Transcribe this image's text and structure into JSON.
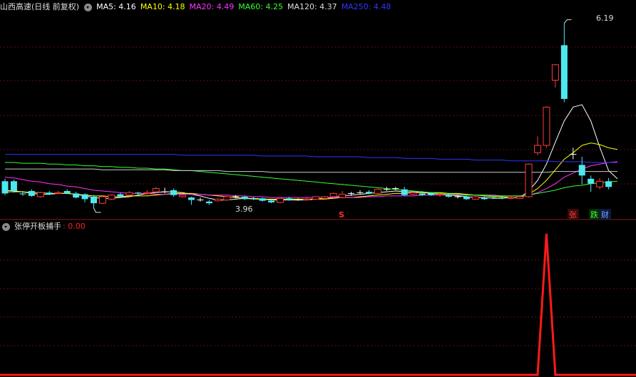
{
  "main_panel": {
    "title": "山西高速(日线 前复权)",
    "ma_items": [
      {
        "label": "MA5: 4.16",
        "color": "#ffffff"
      },
      {
        "label": "MA10: 4.18",
        "color": "#ffff00"
      },
      {
        "label": "MA20: 4.49",
        "color": "#ff33ff"
      },
      {
        "label": "MA60: 4.25",
        "color": "#33ff33"
      },
      {
        "label": "MA120: 4.37",
        "color": "#dddddd"
      },
      {
        "label": "MA250: 4.48",
        "color": "#3333ff"
      }
    ],
    "high_label": "6.19",
    "low_label": "3.96",
    "marker_s": "S",
    "marker_zhang": "张",
    "marker_die": "跌",
    "marker_cai": "财"
  },
  "sub_panel": {
    "title": "张停开板捕手",
    "value": ": 0.00",
    "value_color": "#ff2020"
  },
  "colors": {
    "up": "#ff3b3b",
    "down": "#4de8f0",
    "signal": "#ff1a1a"
  },
  "chart_data": {
    "type": "candlestick",
    "candles": [
      {
        "o": 4.25,
        "c": 4.1,
        "h": 4.28,
        "l": 4.08
      },
      {
        "o": 4.25,
        "c": 4.13,
        "h": 4.27,
        "l": 4.11
      },
      {
        "o": 4.1,
        "c": 4.09,
        "h": 4.13,
        "l": 4.07
      },
      {
        "o": 4.13,
        "c": 4.07,
        "h": 4.15,
        "l": 4.06
      },
      {
        "o": 4.06,
        "c": 4.11,
        "h": 4.12,
        "l": 4.05
      },
      {
        "o": 4.11,
        "c": 4.09,
        "h": 4.13,
        "l": 4.08
      },
      {
        "o": 4.1,
        "c": 4.11,
        "h": 4.13,
        "l": 4.09
      },
      {
        "o": 4.13,
        "c": 4.1,
        "h": 4.15,
        "l": 4.09
      },
      {
        "o": 4.1,
        "c": 4.05,
        "h": 4.12,
        "l": 4.04
      },
      {
        "o": 4.09,
        "c": 4.03,
        "h": 4.1,
        "l": 3.99
      },
      {
        "o": 4.06,
        "c": 3.98,
        "h": 4.08,
        "l": 3.92
      },
      {
        "o": 3.98,
        "c": 4.06,
        "h": 4.08,
        "l": 3.97
      },
      {
        "o": 4.03,
        "c": 4.08,
        "h": 4.09,
        "l": 4.02
      },
      {
        "o": 4.09,
        "c": 4.06,
        "h": 4.11,
        "l": 4.05
      },
      {
        "o": 4.08,
        "c": 4.11,
        "h": 4.13,
        "l": 4.07
      },
      {
        "o": 4.11,
        "c": 4.1,
        "h": 4.12,
        "l": 4.08
      },
      {
        "o": 4.1,
        "c": 4.11,
        "h": 4.14,
        "l": 4.08
      },
      {
        "o": 4.12,
        "c": 4.16,
        "h": 4.18,
        "l": 4.1
      },
      {
        "o": 4.12,
        "c": 4.12,
        "h": 4.17,
        "l": 4.1
      },
      {
        "o": 4.14,
        "c": 4.08,
        "h": 4.16,
        "l": 4.06
      },
      {
        "o": 4.06,
        "c": 4.08,
        "h": 4.09,
        "l": 4.05
      },
      {
        "o": 4.05,
        "c": 4.02,
        "h": 4.06,
        "l": 3.96
      },
      {
        "o": 4.02,
        "c": 4.02,
        "h": 4.05,
        "l": 4.0
      },
      {
        "o": 4.0,
        "c": 3.98,
        "h": 4.02,
        "l": 3.96
      },
      {
        "o": 4.01,
        "c": 4.03,
        "h": 4.04,
        "l": 4.0
      },
      {
        "o": 4.02,
        "c": 4.06,
        "h": 4.07,
        "l": 4.01
      },
      {
        "o": 4.06,
        "c": 4.06,
        "h": 4.08,
        "l": 4.04
      },
      {
        "o": 4.06,
        "c": 4.03,
        "h": 4.07,
        "l": 4.02
      },
      {
        "o": 4.04,
        "c": 4.03,
        "h": 4.06,
        "l": 4.02
      },
      {
        "o": 4.04,
        "c": 4.01,
        "h": 4.05,
        "l": 4.0
      },
      {
        "o": 4.01,
        "c": 3.99,
        "h": 4.03,
        "l": 3.98
      },
      {
        "o": 3.99,
        "c": 4.04,
        "h": 4.05,
        "l": 3.98
      },
      {
        "o": 4.04,
        "c": 4.02,
        "h": 4.06,
        "l": 4.01
      },
      {
        "o": 4.02,
        "c": 4.02,
        "h": 4.04,
        "l": 4.01
      },
      {
        "o": 4.02,
        "c": 4.03,
        "h": 4.05,
        "l": 4.01
      },
      {
        "o": 4.03,
        "c": 4.06,
        "h": 4.07,
        "l": 4.02
      },
      {
        "o": 4.04,
        "c": 4.06,
        "h": 4.07,
        "l": 4.03
      },
      {
        "o": 4.06,
        "c": 4.1,
        "h": 4.11,
        "l": 4.05
      },
      {
        "o": 4.05,
        "c": 4.09,
        "h": 4.13,
        "l": 4.04
      },
      {
        "o": 4.1,
        "c": 4.1,
        "h": 4.12,
        "l": 4.07
      },
      {
        "o": 4.11,
        "c": 4.11,
        "h": 4.14,
        "l": 4.09
      },
      {
        "o": 4.12,
        "c": 4.1,
        "h": 4.14,
        "l": 4.09
      },
      {
        "o": 4.1,
        "c": 4.15,
        "h": 4.16,
        "l": 4.09
      },
      {
        "o": 4.15,
        "c": 4.15,
        "h": 4.18,
        "l": 4.13
      },
      {
        "o": 4.16,
        "c": 4.16,
        "h": 4.18,
        "l": 4.14
      },
      {
        "o": 4.15,
        "c": 4.08,
        "h": 4.18,
        "l": 4.07
      },
      {
        "o": 4.09,
        "c": 4.11,
        "h": 4.12,
        "l": 4.08
      },
      {
        "o": 4.1,
        "c": 4.08,
        "h": 4.13,
        "l": 4.07
      },
      {
        "o": 4.1,
        "c": 4.08,
        "h": 4.11,
        "l": 4.07
      },
      {
        "o": 4.08,
        "c": 4.09,
        "h": 4.1,
        "l": 4.06
      },
      {
        "o": 4.08,
        "c": 4.06,
        "h": 4.1,
        "l": 4.05
      },
      {
        "o": 4.06,
        "c": 4.06,
        "h": 4.08,
        "l": 4.04
      },
      {
        "o": 4.06,
        "c": 4.03,
        "h": 4.07,
        "l": 4.02
      },
      {
        "o": 4.03,
        "c": 4.06,
        "h": 4.07,
        "l": 4.02
      },
      {
        "o": 4.05,
        "c": 4.03,
        "h": 4.06,
        "l": 4.02
      },
      {
        "o": 4.05,
        "c": 4.04,
        "h": 4.06,
        "l": 4.03
      },
      {
        "o": 4.05,
        "c": 4.04,
        "h": 4.06,
        "l": 4.03
      },
      {
        "o": 4.04,
        "c": 4.05,
        "h": 4.07,
        "l": 4.03
      },
      {
        "o": 4.04,
        "c": 4.06,
        "h": 4.07,
        "l": 4.03
      },
      {
        "o": 4.06,
        "c": 4.46,
        "h": 4.47,
        "l": 4.05
      },
      {
        "o": 4.6,
        "c": 4.69,
        "h": 4.8,
        "l": 4.57
      },
      {
        "o": 4.69,
        "c": 5.16,
        "h": 5.17,
        "l": 4.66
      },
      {
        "o": 5.49,
        "c": 5.68,
        "h": 5.69,
        "l": 5.4
      },
      {
        "o": 5.92,
        "c": 5.26,
        "h": 6.19,
        "l": 5.22
      },
      {
        "o": 4.58,
        "c": 4.58,
        "h": 4.66,
        "l": 4.52
      },
      {
        "o": 4.45,
        "c": 4.32,
        "h": 4.55,
        "l": 4.21
      },
      {
        "o": 4.28,
        "c": 4.22,
        "h": 4.32,
        "l": 4.12
      },
      {
        "o": 4.18,
        "c": 4.25,
        "h": 4.29,
        "l": 4.15
      },
      {
        "o": 4.25,
        "c": 4.18,
        "h": 4.29,
        "l": 4.15
      }
    ],
    "ma_lines": {
      "MA5": [
        4.14,
        4.13,
        4.12,
        4.1,
        4.09,
        4.09,
        4.1,
        4.1,
        4.09,
        4.07,
        4.05,
        4.04,
        4.04,
        4.05,
        4.06,
        4.08,
        4.1,
        4.11,
        4.12,
        4.12,
        4.11,
        4.09,
        4.07,
        4.04,
        4.02,
        4.02,
        4.03,
        4.04,
        4.04,
        4.03,
        4.02,
        4.02,
        4.02,
        4.02,
        4.02,
        4.03,
        4.04,
        4.05,
        4.07,
        4.08,
        4.09,
        4.1,
        4.11,
        4.12,
        4.13,
        4.12,
        4.12,
        4.11,
        4.1,
        4.09,
        4.08,
        4.07,
        4.06,
        4.05,
        4.05,
        4.04,
        4.04,
        4.05,
        4.05,
        4.13,
        4.26,
        4.46,
        4.73,
        4.99,
        5.16,
        5.19,
        4.99,
        4.67,
        4.38,
        4.28
      ],
      "MA10": [
        4.12,
        4.12,
        4.12,
        4.11,
        4.11,
        4.1,
        4.1,
        4.1,
        4.09,
        4.08,
        4.07,
        4.07,
        4.06,
        4.06,
        4.07,
        4.07,
        4.07,
        4.08,
        4.09,
        4.1,
        4.1,
        4.1,
        4.09,
        4.08,
        4.07,
        4.06,
        4.05,
        4.04,
        4.03,
        4.03,
        4.03,
        4.03,
        4.03,
        4.03,
        4.03,
        4.03,
        4.03,
        4.04,
        4.05,
        4.05,
        4.06,
        4.07,
        4.08,
        4.09,
        4.1,
        4.1,
        4.11,
        4.11,
        4.11,
        4.11,
        4.1,
        4.1,
        4.09,
        4.08,
        4.07,
        4.06,
        4.06,
        4.05,
        4.05,
        4.09,
        4.16,
        4.26,
        4.39,
        4.52,
        4.6,
        4.69,
        4.72,
        4.7,
        4.66,
        4.64
      ],
      "MA20": [
        4.3,
        4.29,
        4.27,
        4.25,
        4.24,
        4.22,
        4.21,
        4.19,
        4.18,
        4.16,
        4.14,
        4.13,
        4.12,
        4.11,
        4.1,
        4.1,
        4.1,
        4.09,
        4.09,
        4.09,
        4.09,
        4.09,
        4.09,
        4.08,
        4.08,
        4.08,
        4.07,
        4.07,
        4.06,
        4.06,
        4.05,
        4.05,
        4.05,
        4.05,
        4.05,
        4.05,
        4.05,
        4.05,
        4.05,
        4.05,
        4.05,
        4.06,
        4.06,
        4.07,
        4.07,
        4.07,
        4.07,
        4.08,
        4.08,
        4.08,
        4.08,
        4.08,
        4.08,
        4.08,
        4.08,
        4.08,
        4.07,
        4.07,
        4.07,
        4.08,
        4.11,
        4.16,
        4.22,
        4.3,
        4.35,
        4.4,
        4.44,
        4.46,
        4.48,
        4.49
      ],
      "MA60": [
        4.48,
        4.48,
        4.47,
        4.47,
        4.47,
        4.46,
        4.46,
        4.45,
        4.45,
        4.44,
        4.44,
        4.43,
        4.43,
        4.42,
        4.42,
        4.41,
        4.41,
        4.4,
        4.4,
        4.39,
        4.38,
        4.38,
        4.37,
        4.36,
        4.35,
        4.34,
        4.33,
        4.32,
        4.31,
        4.3,
        4.29,
        4.28,
        4.27,
        4.26,
        4.25,
        4.24,
        4.23,
        4.22,
        4.21,
        4.2,
        4.19,
        4.18,
        4.17,
        4.16,
        4.15,
        4.14,
        4.13,
        4.12,
        4.11,
        4.1,
        4.09,
        4.09,
        4.08,
        4.08,
        4.08,
        4.07,
        4.07,
        4.07,
        4.07,
        4.08,
        4.1,
        4.12,
        4.14,
        4.17,
        4.19,
        4.2,
        4.22,
        4.23,
        4.24,
        4.25
      ],
      "MA120": [
        4.4,
        4.4,
        4.4,
        4.4,
        4.4,
        4.4,
        4.4,
        4.4,
        4.4,
        4.4,
        4.4,
        4.39,
        4.39,
        4.39,
        4.39,
        4.39,
        4.39,
        4.39,
        4.39,
        4.38,
        4.38,
        4.38,
        4.38,
        4.38,
        4.38,
        4.37,
        4.37,
        4.37,
        4.37,
        4.37,
        4.36,
        4.36,
        4.36,
        4.36,
        4.36,
        4.36,
        4.36,
        4.36,
        4.36,
        4.36,
        4.36,
        4.36,
        4.36,
        4.36,
        4.36,
        4.36,
        4.36,
        4.36,
        4.36,
        4.36,
        4.36,
        4.36,
        4.36,
        4.36,
        4.36,
        4.36,
        4.36,
        4.36,
        4.36,
        4.36,
        4.36,
        4.36,
        4.37,
        4.37,
        4.37,
        4.37,
        4.37,
        4.37,
        4.37,
        4.37
      ],
      "MA250": [
        4.58,
        4.58,
        4.58,
        4.58,
        4.58,
        4.58,
        4.58,
        4.58,
        4.58,
        4.58,
        4.58,
        4.58,
        4.58,
        4.58,
        4.58,
        4.58,
        4.58,
        4.58,
        4.58,
        4.58,
        4.57,
        4.57,
        4.57,
        4.57,
        4.57,
        4.57,
        4.57,
        4.57,
        4.57,
        4.56,
        4.56,
        4.56,
        4.56,
        4.56,
        4.56,
        4.55,
        4.55,
        4.55,
        4.55,
        4.55,
        4.55,
        4.54,
        4.54,
        4.54,
        4.54,
        4.53,
        4.53,
        4.53,
        4.53,
        4.52,
        4.52,
        4.52,
        4.52,
        4.51,
        4.51,
        4.51,
        4.51,
        4.5,
        4.5,
        4.5,
        4.5,
        4.5,
        4.49,
        4.49,
        4.49,
        4.49,
        4.48,
        4.48,
        4.48,
        4.48
      ]
    },
    "signal": {
      "name": "张停开板捕手",
      "values": [
        0,
        0,
        0,
        0,
        0,
        0,
        0,
        0,
        0,
        0,
        0,
        0,
        0,
        0,
        0,
        0,
        0,
        0,
        0,
        0,
        0,
        0,
        0,
        0,
        0,
        0,
        0,
        0,
        0,
        0,
        0,
        0,
        0,
        0,
        0,
        0,
        0,
        0,
        0,
        0,
        0,
        0,
        0,
        0,
        0,
        0,
        0,
        0,
        0,
        0,
        0,
        0,
        0,
        0,
        0,
        0,
        0,
        0,
        0,
        0,
        0,
        1,
        0,
        0,
        0,
        0,
        0,
        0,
        0,
        0
      ],
      "ylim": [
        0,
        1
      ]
    },
    "ylim": [
      3.85,
      6.3
    ],
    "grid": true
  }
}
